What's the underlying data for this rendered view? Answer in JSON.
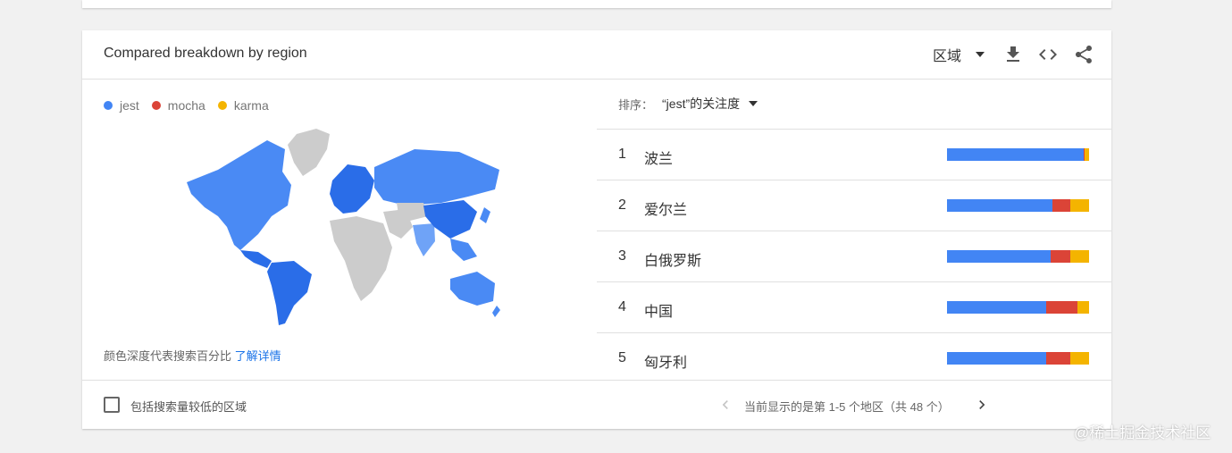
{
  "card_title": "Compared breakdown by region",
  "header": {
    "region_label": "区域",
    "icons": [
      "chevron-down-icon",
      "download-icon",
      "embed-code-icon",
      "share-icon"
    ]
  },
  "legend": [
    {
      "name": "jest",
      "color": "#4285f4"
    },
    {
      "name": "mocha",
      "color": "#db4437"
    },
    {
      "name": "karma",
      "color": "#f4b400"
    }
  ],
  "map_note": {
    "text": "颜色深度代表搜索百分比",
    "link": "了解详情"
  },
  "sort": {
    "label": "排序：",
    "value": "“jest”的关注度"
  },
  "regions": [
    {
      "rank": "1",
      "name": "波兰",
      "shares": [
        96,
        1,
        3
      ]
    },
    {
      "rank": "2",
      "name": "爱尔兰",
      "shares": [
        74,
        13,
        13
      ]
    },
    {
      "rank": "3",
      "name": "白俄罗斯",
      "shares": [
        73,
        14,
        13
      ]
    },
    {
      "rank": "4",
      "name": "中国",
      "shares": [
        70,
        22,
        8
      ]
    },
    {
      "rank": "5",
      "name": "匈牙利",
      "shares": [
        70,
        17,
        13
      ]
    }
  ],
  "footer": {
    "checkbox_label": "包括搜索量较低的区域",
    "pager_text": "当前显示的是第 1-5 个地区（共 48 个）"
  },
  "colors": {
    "jest": "#4285f4",
    "mocha": "#db4437",
    "karma": "#f4b400",
    "map_no_data": "#cccccc",
    "map_dark": "#2a6de8",
    "map_mid": "#4a8af4",
    "map_light": "#6fa3f7"
  },
  "watermark": "@稀土掘金技术社区"
}
